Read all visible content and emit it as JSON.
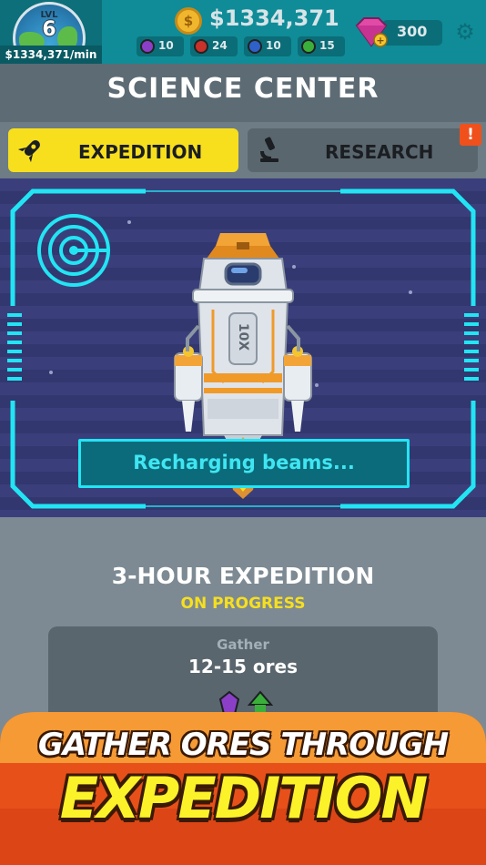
{
  "topbar": {
    "level_label": "LVL",
    "level": "6",
    "rate": "$1334,371/min",
    "money": "$1334,371",
    "gems": "300",
    "coin_icon": "dollar-coin-icon",
    "gem_icon": "pink-diamond-icon",
    "settings_icon": "gear-icon",
    "ores": [
      {
        "name": "purple-ore",
        "value": "10",
        "color": "#8b3fc6"
      },
      {
        "name": "red-ore",
        "value": "24",
        "color": "#c8322a"
      },
      {
        "name": "blue-ore",
        "value": "10",
        "color": "#2e62c9"
      },
      {
        "name": "green-ore",
        "value": "15",
        "color": "#3ab03a"
      }
    ]
  },
  "header": {
    "title": "SCIENCE CENTER"
  },
  "tabs": {
    "expedition": {
      "label": "EXPEDITION",
      "icon": "rocket-icon",
      "active": true
    },
    "research": {
      "label": "RESEARCH",
      "icon": "microscope-icon",
      "alert": "!"
    }
  },
  "scene": {
    "status": "Recharging beams...",
    "rocket_label": "10X",
    "radar_icon": "radar-icon"
  },
  "expedition": {
    "title": "3-HOUR EXPEDITION",
    "status": "ON PROGRESS",
    "card_label": "Gather",
    "card_value": "12-15 ores"
  },
  "banner": {
    "line1": "GATHER ORES THROUGH",
    "line2": "EXPEDITION"
  },
  "colors": {
    "accent_yellow": "#f7df1e",
    "teal": "#0f8c98",
    "cyan_frame": "#22e5f4",
    "banner_orange": "#f0601c"
  }
}
